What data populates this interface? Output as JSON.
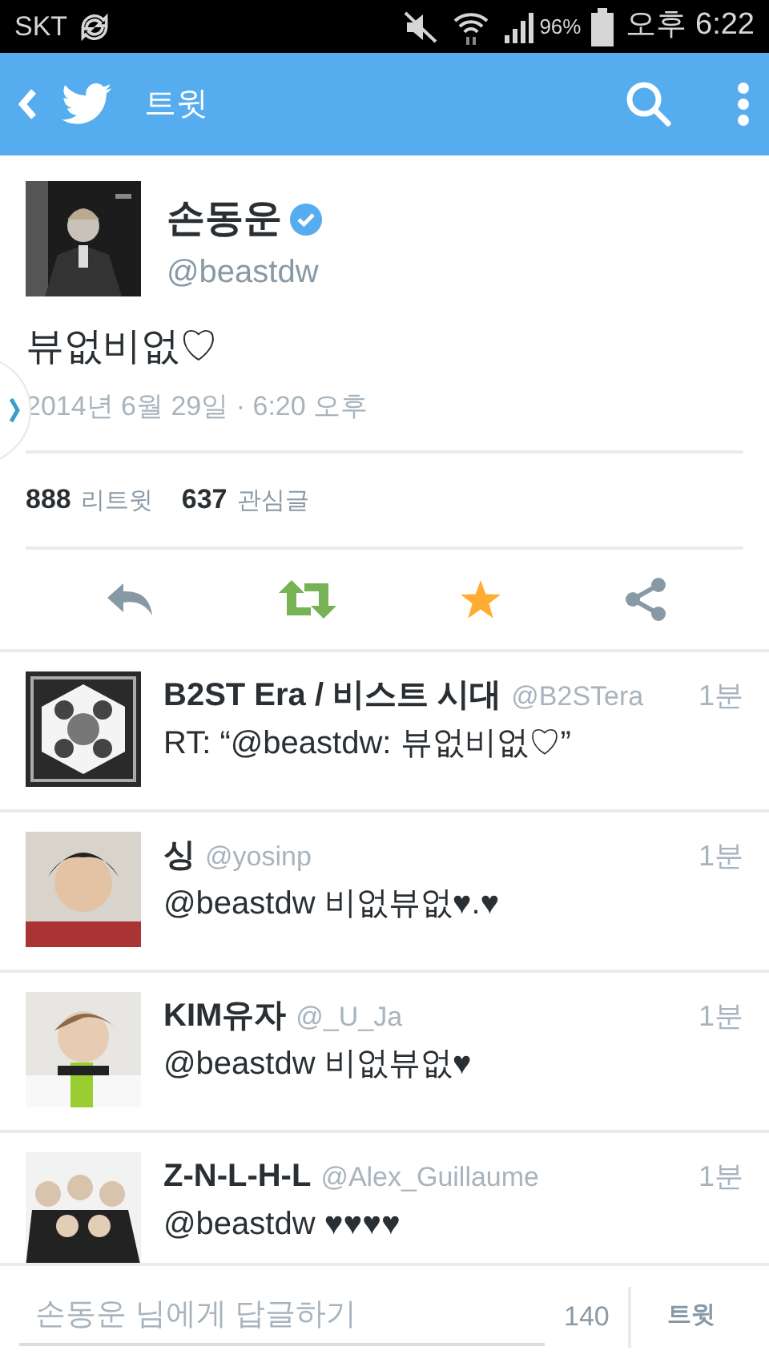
{
  "status_bar": {
    "carrier": "SKT",
    "battery": "96%",
    "time": "오후 6:22"
  },
  "header": {
    "title": "트윗"
  },
  "tweet": {
    "name": "손동운",
    "verified": true,
    "handle": "@beastdw",
    "text": "뷰없비없♡",
    "date": "2014년 6월 29일 · 6:20 오후",
    "stats": [
      {
        "count": "888",
        "label": "리트윗"
      },
      {
        "count": "637",
        "label": "관심글"
      }
    ],
    "actions": [
      {
        "kind": "reply"
      },
      {
        "kind": "retweet"
      },
      {
        "kind": "favorite"
      },
      {
        "kind": "share"
      }
    ]
  },
  "replies": [
    {
      "name": "B2ST Era / 비스트 시대",
      "handle": "@B2STera",
      "time": "1분",
      "text": "RT: “@beastdw: 뷰없비없♡”"
    },
    {
      "name": "싱",
      "handle": "@yosinp",
      "time": "1분",
      "text": "@beastdw 비없뷰없♥.♥"
    },
    {
      "name": "KIM유자",
      "handle": "@_U_Ja",
      "time": "1분",
      "text": "@beastdw 비없뷰없♥"
    },
    {
      "name": "Z-N-L-H-L",
      "handle": "@Alex_Guillaume",
      "time": "1분",
      "text": "@beastdw ♥♥♥♥"
    }
  ],
  "composer": {
    "placeholder": "손동운 님에게 답글하기",
    "counter": "140",
    "button": "트윗"
  }
}
